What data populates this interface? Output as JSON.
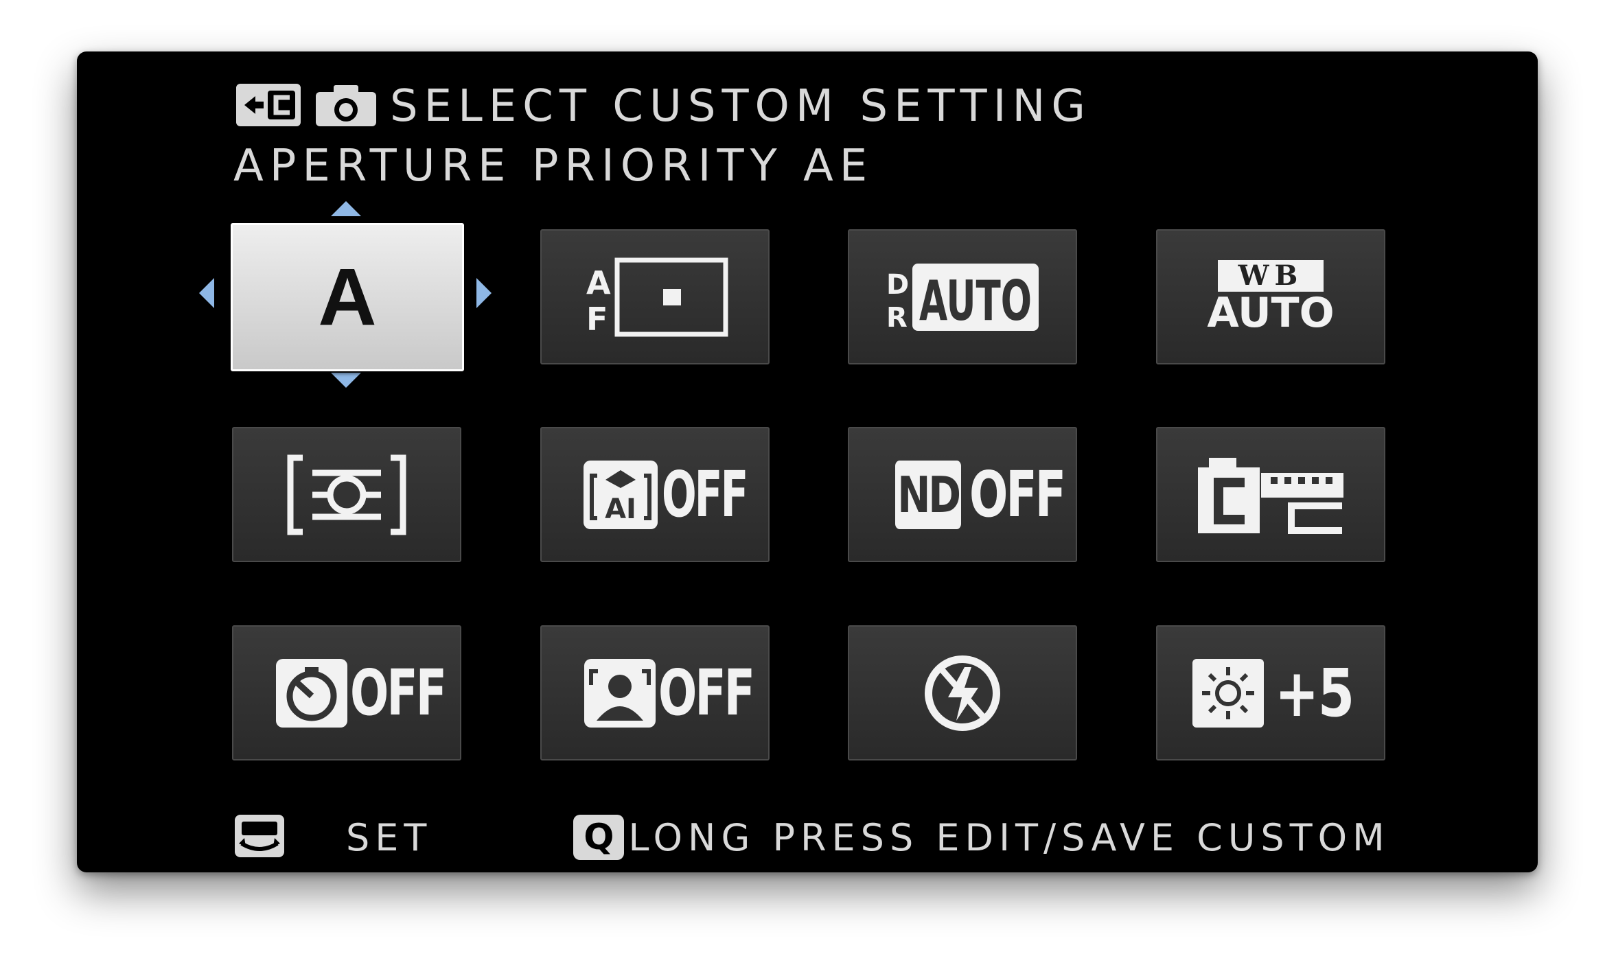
{
  "header": {
    "title": "SELECT CUSTOM SETTING",
    "subtitle": "APERTURE PRIORITY AE",
    "icons": [
      "custom-save-icon",
      "camera-icon"
    ]
  },
  "grid": {
    "tiles": [
      {
        "id": "shooting-mode",
        "label": "A",
        "icon": "mode-letter",
        "selected": true
      },
      {
        "id": "af-mode",
        "label": "AF",
        "icon": "single-point-af-icon"
      },
      {
        "id": "dynamic-range",
        "label": "AUTO",
        "prefix": "DR",
        "icon": "dynamic-range-icon"
      },
      {
        "id": "white-balance",
        "label_top": "WB",
        "label": "AUTO",
        "icon": "white-balance-icon"
      },
      {
        "id": "metering",
        "icon": "multi-metering-icon"
      },
      {
        "id": "advanced-filter",
        "label": "OFF",
        "icon": "ai-scene-icon"
      },
      {
        "id": "nd-filter",
        "prefix": "ND",
        "label": "OFF",
        "icon": "nd-filter-icon"
      },
      {
        "id": "film-simulation",
        "icon": "film-simulation-c-icon"
      },
      {
        "id": "self-timer",
        "label": "OFF",
        "icon": "self-timer-icon"
      },
      {
        "id": "face-detection",
        "label": "OFF",
        "icon": "face-detection-icon"
      },
      {
        "id": "flash",
        "icon": "flash-off-icon"
      },
      {
        "id": "lcd-brightness",
        "label": "+5",
        "icon": "brightness-icon"
      }
    ]
  },
  "footer": {
    "set_label": "SET",
    "q_key": "Q",
    "q_hint": "LONG PRESS EDIT/SAVE CUSTOM"
  },
  "colors": {
    "screen_bg": "#000000",
    "tile_bg": "#333333",
    "tile_selected_bg": "#dcdcdc",
    "text": "#d9d9d9",
    "arrow": "#8fb8e6"
  }
}
